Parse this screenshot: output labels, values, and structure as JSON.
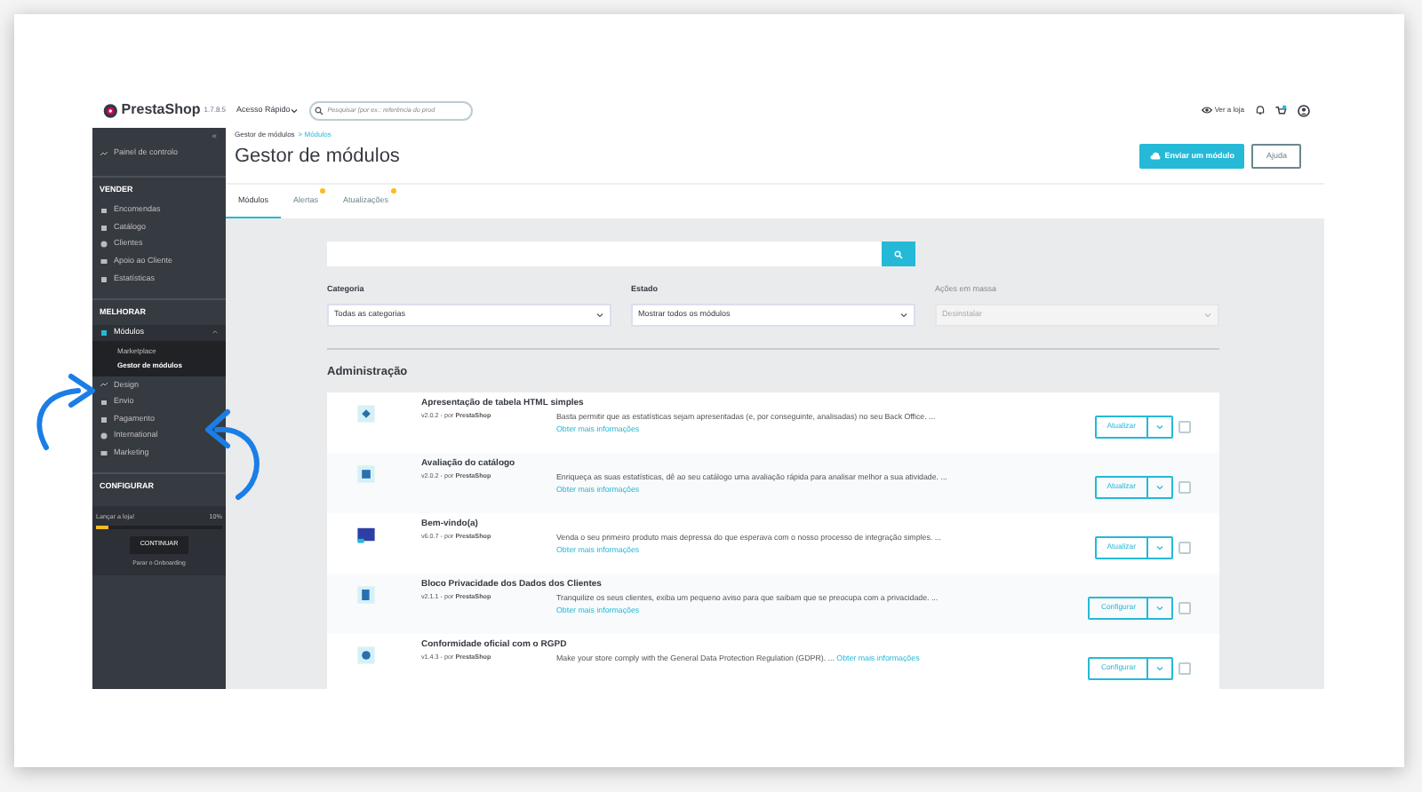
{
  "header": {
    "logo": "PrestaShop",
    "version": "1.7.8.5",
    "quick_access": "Acesso Rápido",
    "search": {
      "placeholder": "Pesquisar (por ex.: referência do prod"
    },
    "view_shop": "Ver a loja"
  },
  "sidebar": {
    "collapse": "«",
    "sections": [
      {
        "items": [
          {
            "label": "Painel de controlo",
            "selected": false,
            "expanded": false
          }
        ]
      },
      {
        "title": "VENDER",
        "items": [
          {
            "label": "Encomendas",
            "selected": false,
            "expanded": false
          },
          {
            "label": "Catálogo",
            "selected": false,
            "expanded": false
          },
          {
            "label": "Clientes",
            "selected": false,
            "expanded": false
          },
          {
            "label": "Apoio ao Cliente",
            "selected": false,
            "expanded": false
          },
          {
            "label": "Estatísticas",
            "selected": false,
            "expanded": false
          }
        ]
      },
      {
        "title": "MELHORAR",
        "items": [
          {
            "label": "Módulos",
            "selected": true,
            "expanded": true,
            "children": [
              {
                "label": "Marketplace",
                "selected": false
              },
              {
                "label": "Gestor de módulos",
                "selected": true
              }
            ]
          },
          {
            "label": "Design",
            "selected": false,
            "expanded": false
          },
          {
            "label": "Envio",
            "selected": false,
            "expanded": false
          },
          {
            "label": "Pagamento",
            "selected": false,
            "expanded": false
          },
          {
            "label": "International",
            "selected": false,
            "expanded": false
          },
          {
            "label": "Marketing",
            "selected": false,
            "expanded": false
          }
        ]
      },
      {
        "title": "CONFIGURAR"
      }
    ],
    "onboarding": {
      "label": "Lançar a loja!",
      "percent": "10%",
      "level": 0.1,
      "button": "CONTINUAR",
      "stop": "Parar o Onboarding"
    }
  },
  "breadcrumb": [
    "Gestor de módulos",
    "> Módulos"
  ],
  "title": "Gestor de módulos",
  "toolbar": [
    "Enviar um módulo",
    "Ajuda"
  ],
  "tabs": [
    {
      "label": "Módulos",
      "selected": true,
      "badge": false
    },
    {
      "label": "Alertas",
      "selected": false,
      "badge": true
    },
    {
      "label": "Atualizações",
      "selected": false,
      "badge": true
    }
  ],
  "filters": [
    {
      "label": "Categoria",
      "value": "Todas as categorias",
      "disabled": false
    },
    {
      "label": "Estado",
      "value": "Mostrar todos os módulos",
      "disabled": false
    },
    {
      "label": "Ações em massa",
      "value": "Desinstalar",
      "disabled": true
    }
  ],
  "section_title": "Administração",
  "modules": [
    {
      "name": "Apresentação de tabela HTML simples",
      "version": "v2.0.2 - por",
      "author": "PrestaShop",
      "description": "Basta permitir que as estatísticas sejam apresentadas (e, por conseguinte, analisadas) no seu Back Office. ...",
      "link": "Obter mais informações",
      "action": "Atualizar",
      "checked": false
    },
    {
      "name": "Avaliação do catálogo",
      "version": "v2.0.2 - por",
      "author": "PrestaShop",
      "description": "Enriqueça as suas estatísticas, dê ao seu catálogo uma avaliação rápida para analisar melhor a sua atividade. ...",
      "link": "Obter mais informações",
      "action": "Atualizar",
      "checked": false
    },
    {
      "name": "Bem-vindo(a)",
      "version": "v6.0.7 - por",
      "author": "PrestaShop",
      "description": "Venda o seu primeiro produto mais depressa do que esperava com o nosso processo de integração simples. ...",
      "link": "Obter mais informações",
      "action": "Atualizar",
      "checked": false
    },
    {
      "name": "Bloco Privacidade dos Dados dos Clientes",
      "version": "v2.1.1 - por",
      "author": "PrestaShop",
      "description": "Tranquilize os seus clientes, exiba um pequeno aviso para que saibam que se preocupa com a privacidade. ...",
      "link": "Obter mais informações",
      "action": "Configurar",
      "checked": false
    },
    {
      "name": "Conformidade oficial com o RGPD",
      "version": "v1.4.3 - por",
      "author": "PrestaShop",
      "description": "Make your store comply with the General Data Protection Regulation (GDPR). ...",
      "link": "Obter mais informações",
      "action": "Configurar",
      "checked": false
    }
  ]
}
